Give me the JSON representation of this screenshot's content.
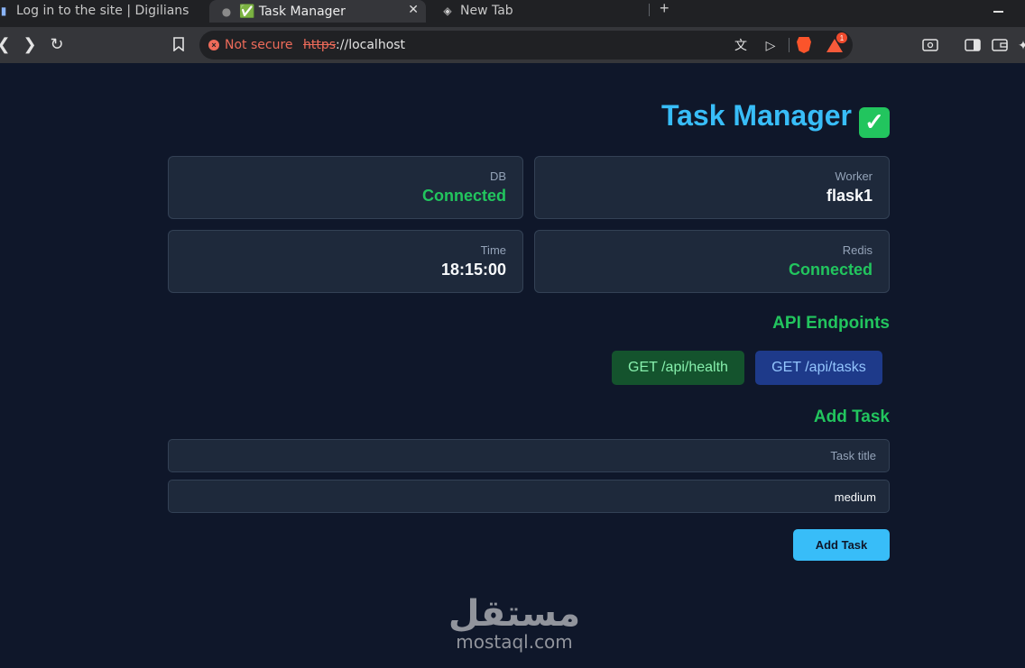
{
  "browser": {
    "tabs": [
      {
        "title": "Log in to the site | Digilians",
        "active": false
      },
      {
        "title": "✅ Task Manager",
        "active": true
      },
      {
        "title": "New Tab",
        "active": false
      }
    ],
    "new_tab_glyph": "+",
    "security_label": "Not secure",
    "url_scheme": "https",
    "url_rest": "://localhost",
    "extension_badge": "1"
  },
  "app": {
    "title": "Task Manager",
    "title_emoji": "✓",
    "stats": [
      {
        "label": "DB",
        "value": "Connected",
        "status": "ok"
      },
      {
        "label": "Worker",
        "value": "flask1",
        "status": "plain"
      },
      {
        "label": "Time",
        "value": "18:15:00",
        "status": "plain"
      },
      {
        "label": "Redis",
        "value": "Connected",
        "status": "ok"
      }
    ],
    "endpoints_heading": "API Endpoints",
    "endpoints": [
      {
        "label": "GET /api/health"
      },
      {
        "label": "GET /api/tasks"
      }
    ],
    "add_task_heading": "Add Task",
    "title_input": {
      "placeholder": "Task title",
      "value": ""
    },
    "priority_select": {
      "value": "medium"
    },
    "submit_label": "Add Task"
  },
  "watermark": {
    "arabic": "مستقل",
    "latin": "mostaql.com"
  },
  "colors": {
    "background": "#0f172a",
    "card": "#1e293b",
    "accent_blue": "#38bdf8",
    "status_green": "#22c55e"
  }
}
